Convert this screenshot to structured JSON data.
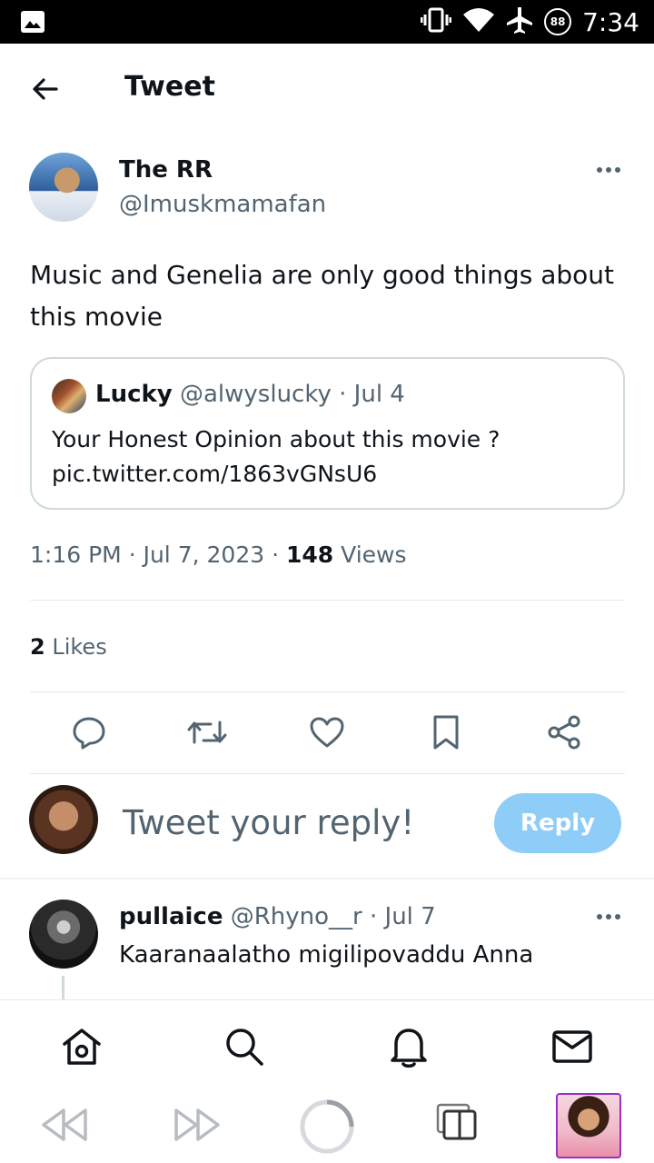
{
  "status_bar": {
    "time": "7:34",
    "battery": "88"
  },
  "header": {
    "title": "Tweet"
  },
  "tweet": {
    "author_name": "The RR",
    "author_handle": "@Imuskmamafan",
    "text": "Music and Genelia are only good things about this movie",
    "quote": {
      "name": "Lucky",
      "handle": "@alwyslucky",
      "date": "· Jul 4",
      "text": "Your Honest Opinion about this movie ?",
      "link": "pic.twitter.com/1863vGNsU6"
    },
    "time": "1:16 PM",
    "date": "Jul 7, 2023",
    "views_count": "148",
    "views_label": "Views",
    "likes_count": "2",
    "likes_label": "Likes"
  },
  "reply_box": {
    "placeholder": "Tweet your reply!",
    "button_label": "Reply"
  },
  "replies": [
    {
      "name": "pullaice",
      "handle": "@Rhyno__r",
      "date": "· Jul 7",
      "text": "Kaaranaalatho migilipovaddu Anna"
    }
  ],
  "icons": {
    "back": "arrow-left-icon",
    "more": "more-dots-icon",
    "reply": "comment-icon",
    "retweet": "retweet-icon",
    "like": "heart-icon",
    "bookmark": "bookmark-icon",
    "share": "share-icon",
    "home": "home-icon",
    "search": "search-icon",
    "notifications": "bell-icon",
    "messages": "mail-icon"
  },
  "colors": {
    "accent": "#1d9bf0",
    "reply_button": "#8ecdf8",
    "secondary_text": "#536471"
  }
}
